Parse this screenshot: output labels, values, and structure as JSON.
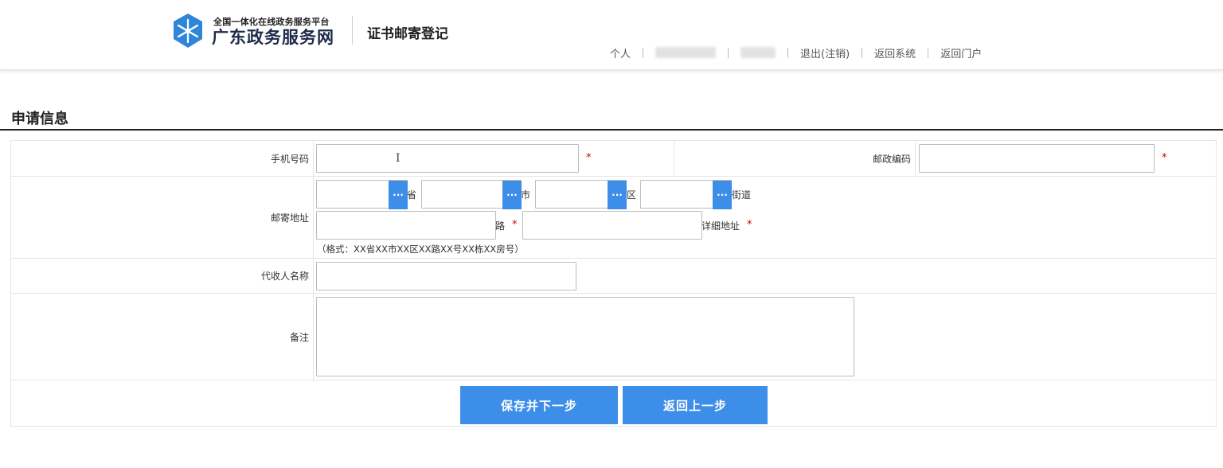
{
  "header": {
    "logo_subtitle": "全国一体化在线政务服务平台",
    "logo_title": "广东政务服务网",
    "page_name": "证书邮寄登记",
    "nav": {
      "personal": "个人",
      "logout": "退出(注销)",
      "back_system": "返回系统",
      "back_portal": "返回门户"
    }
  },
  "section": {
    "title": "申请信息"
  },
  "form": {
    "phone": {
      "label": "手机号码",
      "value": "",
      "required_mark": "*"
    },
    "postcode": {
      "label": "邮政编码",
      "value": "",
      "required_mark": "*"
    },
    "address": {
      "label": "邮寄地址",
      "province_suffix": "省",
      "city_suffix": "市",
      "district_suffix": "区",
      "street_suffix": "街道",
      "road_suffix": "路",
      "detail_suffix": "详细地址",
      "required_mark": "*",
      "picker_glyph": "···",
      "hint": "（格式：XX省XX市XX区XX路XX号XX栋XX房号）"
    },
    "receiver": {
      "label": "代收人名称",
      "value": ""
    },
    "remark": {
      "label": "备注",
      "value": ""
    }
  },
  "buttons": {
    "save_next": "保存并下一步",
    "back_prev": "返回上一步"
  },
  "colors": {
    "primary": "#3d8ee8",
    "required": "#cc0000",
    "logo": "#2f86d8"
  }
}
